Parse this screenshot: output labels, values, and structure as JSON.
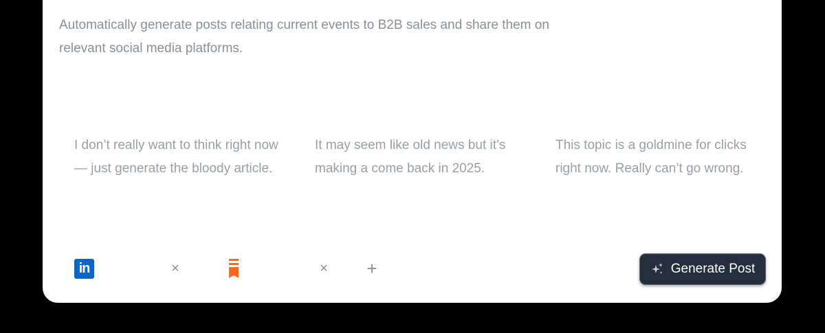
{
  "description": "Automatically generate posts relating current events to B2B sales and share them on relevant social media platforms.",
  "options": [
    {
      "text": "I don’t really want to think right now — just generate the bloody article."
    },
    {
      "text": "It may seem like old news but it’s making a come back in 2025."
    },
    {
      "text": "This topic is a goldmine for clicks right now. Really can’t go wrong."
    }
  ],
  "platforms": {
    "linkedin": {
      "icon": "linkedin-icon",
      "glyph": "in",
      "color": "#0a66c2",
      "remove_glyph": "×"
    },
    "substack": {
      "icon": "substack-icon",
      "color": "#ff6719",
      "remove_glyph": "×"
    },
    "add_glyph": "+"
  },
  "generate_button": {
    "label": "Generate Post",
    "icon": "sparkle-icon"
  }
}
